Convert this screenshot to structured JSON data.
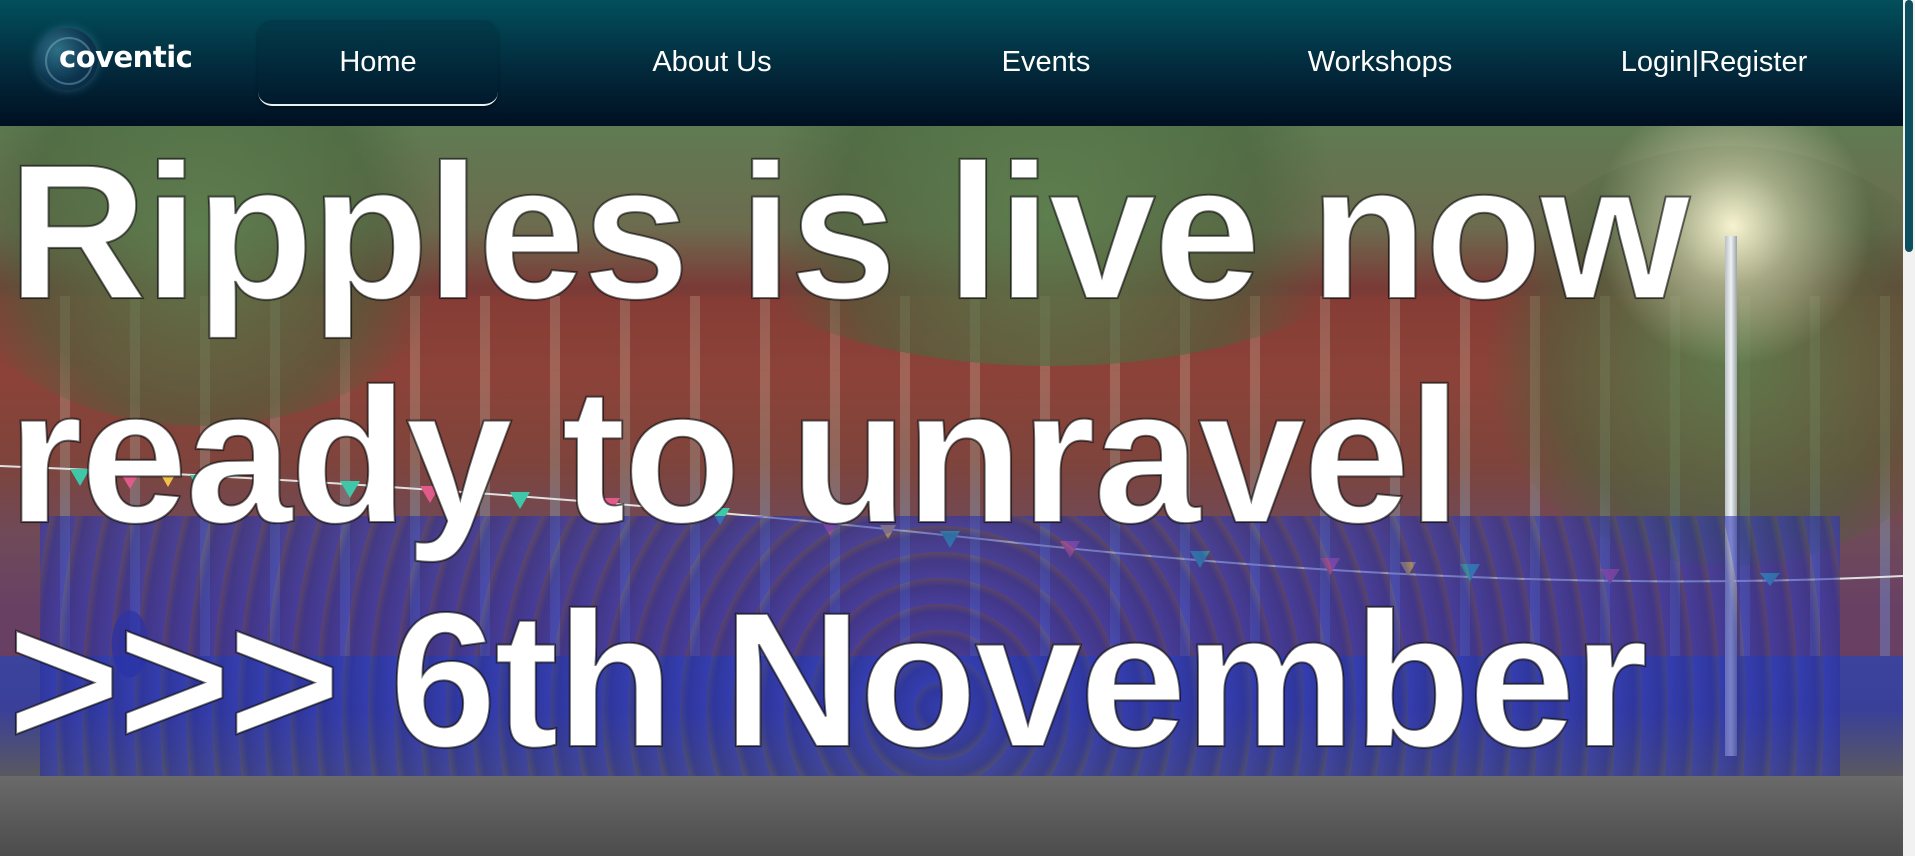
{
  "brand": {
    "logo_text": "coventic",
    "logo_icon": "ripple-circle-icon"
  },
  "nav": {
    "items": [
      {
        "label": "Home",
        "active": true
      },
      {
        "label": "About Us",
        "active": false
      },
      {
        "label": "Events",
        "active": false
      },
      {
        "label": "Workshops",
        "active": false
      },
      {
        "label": "Login|Register",
        "active": false
      }
    ]
  },
  "hero": {
    "lines": [
      "Ripples is live now",
      "ready to unravel",
      ">>> 6th November"
    ]
  },
  "colors": {
    "nav_top": "#024f5c",
    "nav_bottom": "#010f22",
    "text": "#ffffff",
    "crowd_shirt": "#3a40a8",
    "building_brick": "#8c4a40"
  }
}
